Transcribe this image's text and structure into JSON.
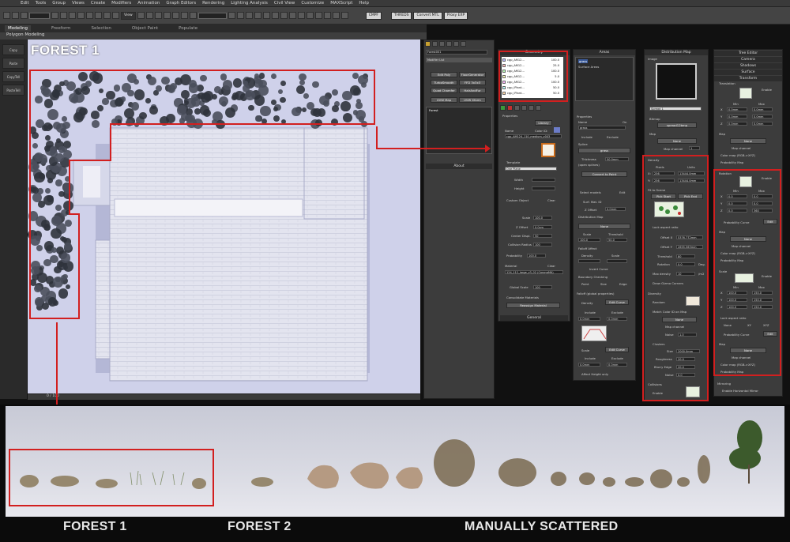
{
  "menubar": [
    "Edit",
    "Tools",
    "Group",
    "Views",
    "Create",
    "Modifiers",
    "Animation",
    "Graph Editors",
    "Rendering",
    "Lighting Analysis",
    "Civil View",
    "Customize",
    "MAXScript",
    "Help"
  ],
  "toolbar": {
    "view_dropdown": "View",
    "buttons": [
      "CMPF",
      "THREDS",
      "Convert MTL",
      "Proxy EXP"
    ]
  },
  "ribbon": {
    "tabs": [
      "Modeling",
      "Freeform",
      "Selection",
      "Object Paint",
      "Populate"
    ],
    "sub": "Polygon Modeling"
  },
  "leftstrip": [
    "Copy",
    "Paste",
    "CopyTell",
    "PasteTell"
  ],
  "viewport": {
    "label": "FOREST 1",
    "frame": "0 / 100"
  },
  "geometry": {
    "title": "Geometry",
    "object": "Forest001",
    "modifier_list": "Modifier List",
    "buttons": [
      "Edit Poly",
      "FloorGenerator",
      "TurboSmooth",
      "FFD 3x3x3",
      "Quad Chamfer",
      "HairAndFur",
      "UVW Map",
      "UVW Xform"
    ],
    "stack": "Forest",
    "about": "About",
    "items": [
      [
        "cgp_AM12...",
        "100.0"
      ],
      [
        "cgp_AM12...",
        "25.0"
      ],
      [
        "cgp_AM12...",
        "100.0"
      ],
      [
        "cgp_AM12...",
        "5.0"
      ],
      [
        "cgp_AM12...",
        "100.0"
      ],
      [
        "cgp_iPlant...",
        "50.0"
      ],
      [
        "cgp_iPlant...",
        "50.0"
      ]
    ],
    "properties": "Properties",
    "library": "Library",
    "name_label": "Name",
    "color_label": "Color ID:",
    "name_value": "cgp_AM124_110_medium_v003",
    "template": "Template",
    "template_value": "One Plane",
    "width_label": "Width",
    "height_label": "Height",
    "custom_object": "Custom Object",
    "clear": "Clear",
    "scale_label": "Scale",
    "scale_value": "100.0",
    "zoffset_label": "Z Offset",
    "zoffset_value": "0.0cm",
    "center_label": "Center Displ.",
    "center_value": "50",
    "collision_label": "Collision Radius",
    "collision_value": "100",
    "prob_label": "Probability",
    "prob_value": "100.0",
    "material_label": "Material",
    "material_value": "124_112_large_v3_02 (CoronaMtl)",
    "global_scale_label": "Global Scale",
    "global_scale_value": "100",
    "consolidate": "Consolidate Materials",
    "reassign": "Reassign Material",
    "general": "General"
  },
  "areas": {
    "title": "Areas",
    "items": [
      "grass",
      "Surface Areas"
    ],
    "properties": "Properties",
    "name_label": "Name",
    "on_label": "On",
    "name_value": "grass",
    "include": "Include",
    "exclude": "Exclude",
    "spline_label": "Spline",
    "spline_value": "grass",
    "thickness_label": "Thickness",
    "thickness_value": "50.0mm",
    "open_label": "(open splines)",
    "convert": "Convert to Paint",
    "select_models": "Select models",
    "edit": "Edit",
    "surf_label": "Surf. Mat. ID",
    "zoffset_label": "Z Offset",
    "zoffset_value": "0.0mm",
    "distribution_map": "Distribution Map",
    "none": "None",
    "scale_label": "Scale",
    "threshold_label": "Threshold",
    "scale_value": "100.0",
    "threshold_value": "50.0",
    "falloff_affect": "Falloff Affect",
    "density_label": "Density",
    "scale2_label": "Scale",
    "invert": "Invert Curve",
    "boundary": "Boundary Checking",
    "point": "Point",
    "size": "Size",
    "edge": "Edge",
    "falloff_global": "Falloff (global properties)",
    "density_chk": "Density",
    "edit_curve": "Edit Curve",
    "include2": "Include",
    "exclude2": "Exclude",
    "value_mm": "0.0mm",
    "scale_chk": "Scale",
    "edit_curve2": "Edit Curve",
    "affect_height": "Affect Height only"
  },
  "distribution": {
    "title": "Distribution Map",
    "image_label": "Image",
    "preset": "Spread 1",
    "bitmap_label": "Bitmap",
    "bitmap_value": "spread12bmp",
    "map_label": "Map",
    "none": "None",
    "map_channel": "Map channel",
    "map_channel_value": "1",
    "density_title": "Density",
    "pixels": "Pixels",
    "units": "Units",
    "x_label": "X:",
    "y_label": "Y:",
    "x_px": "256",
    "y_px": "256",
    "x_units": "13444.0mm",
    "y_units": "13444.0mm",
    "fit": "Fit to Scene",
    "pick_start": "Pick Start",
    "pick_end": "Pick End",
    "lock": "Lock aspect ratio",
    "offset_x_label": "Offset X",
    "offset_x_value": "5376.772mm",
    "offset_y_label": "Offset Y",
    "offset_y_value": "2655.563mm",
    "threshold_label": "Threshold",
    "threshold_value": "80",
    "rotation_label": "Rotation",
    "rotation_value": "0.0",
    "deg": "Deg.",
    "max_density_label": "Max density",
    "max_density_value": "10",
    "m2": "/m2",
    "draw": "Draw Gizmo Corners",
    "diversity": "Diversity",
    "random": "Random",
    "match": "Match Color ID on Map",
    "none2": "None",
    "map_ch2": "Map channel",
    "noise_label": "Noise",
    "noise_value": "1.0",
    "clusters": "Clusters",
    "size_label": "Size",
    "size_value": "2000.0mm",
    "roughness_label": "Roughness",
    "roughness_value": "20.0",
    "blurry_label": "Blurry Edge",
    "blurry_value": "20.0",
    "noise2_label": "Noise",
    "noise2_value": "0.0",
    "collisions": "Collisions",
    "enable": "Enable"
  },
  "right": {
    "tabs": [
      "Tree Editor",
      "Camera",
      "Shadows",
      "Surface",
      "Transform"
    ],
    "translation": "Translation",
    "enable": "Enable",
    "min": "Min",
    "max": "Max",
    "xyz": [
      "X",
      "Y",
      "Z"
    ],
    "tr_values": [
      [
        "0.0mm",
        "0.0mm"
      ],
      [
        "0.0mm",
        "0.0mm"
      ],
      [
        "0.0mm",
        "0.0mm"
      ]
    ],
    "map": "Map",
    "none": "None",
    "map_channel": "Map channel",
    "color_map": "Color map (RGB->XYZ)",
    "prob_map": "Probability Map",
    "rotation": "Rotation",
    "rot_values": [
      [
        "0.0",
        "0.0"
      ],
      [
        "0.0",
        "0.0"
      ],
      [
        "0.0",
        "360"
      ]
    ],
    "prob_curve": "Probability Curve",
    "edit": "Edit",
    "scale": "Scale",
    "scale_values": [
      [
        "100.0",
        "150.0"
      ],
      [
        "100.0",
        "150.0"
      ],
      [
        "100.0",
        "150.0"
      ]
    ],
    "lock": "Lock aspect ratio",
    "none_r": "None",
    "xy": "XY",
    "xyz_r": "XYZ",
    "mirroring": "Mirroring",
    "mirror": "Enable Horizontal Mirror"
  },
  "captions": [
    "FOREST 1",
    "FOREST 2",
    "MANUALLY SCATTERED"
  ],
  "colors": {
    "highlight": "#d21f1f",
    "panel": "#3c3c3c",
    "viewport": "#d4d6ec"
  }
}
